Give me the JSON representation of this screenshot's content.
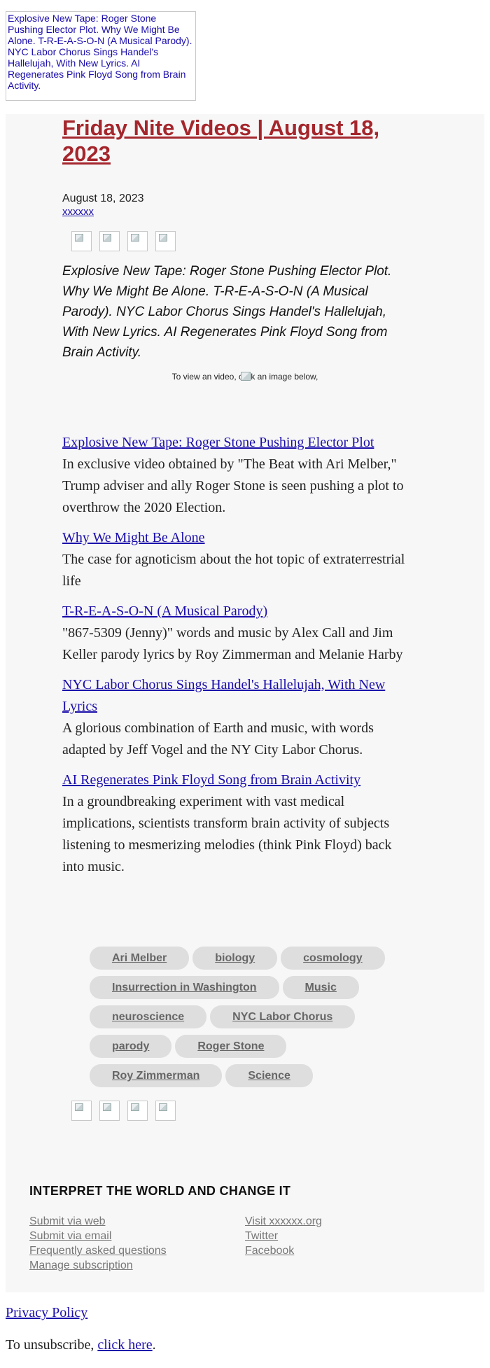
{
  "header": {
    "image_alt": "Explosive New Tape: Roger Stone Pushing Elector Plot. Why We Might Be Alone. T-R-E-A-S-O-N (A Musical Parody). NYC Labor Chorus Sings Handel's Hallelujah, With New Lyrics. AI Regenerates Pink Floyd Song from Brain Activity."
  },
  "article": {
    "title": "Friday Nite Videos | August 18, 2023",
    "date": "August 18, 2023",
    "author": "xxxxxx",
    "intro": "Explosive New Tape: Roger Stone Pushing Elector Plot. Why We Might Be Alone. T-R-E-A-S-O-N (A Musical Parody). NYC Labor Chorus Sings Handel's Hallelujah, With New Lyrics. AI Regenerates Pink Floyd Song from Brain Activity.",
    "view_note": "To view an video, click an image below,"
  },
  "videos": [
    {
      "title": "Explosive New Tape: Roger Stone Pushing Elector Plot",
      "description": "In exclusive video obtained by \"The Beat with Ari Melber,\" Trump adviser and ally Roger Stone is seen pushing a plot to overthrow the 2020 Election."
    },
    {
      "title": "Why We Might Be Alone",
      "description": "The case for agnoticism about the hot topic of extraterrestrial life"
    },
    {
      "title": "T-R-E-A-S-O-N (A Musical Parody)",
      "description": "\"867-5309 (Jenny)\" words and music by Alex Call and Jim Keller parody lyrics by Roy Zimmerman and Melanie Harby"
    },
    {
      "title": "NYC Labor Chorus Sings Handel's Hallelujah, With New Lyrics",
      "description": "A glorious combination of Earth and music, with words adapted by Jeff Vogel and the NY City Labor Chorus."
    },
    {
      "title": "AI Regenerates Pink Floyd Song from Brain Activity",
      "description": "In a groundbreaking experiment with vast medical implications, scientists transform brain activity of subjects listening to mesmerizing melodies (think Pink Floyd) back into music."
    }
  ],
  "tags": [
    "Ari Melber",
    "biology",
    "cosmology",
    "Insurrection in Washington",
    "Music",
    "neuroscience",
    "NYC Labor Chorus",
    "parody",
    "Roger Stone",
    "Roy Zimmerman",
    "Science"
  ],
  "footer": {
    "heading": "INTERPRET THE WORLD AND CHANGE IT",
    "left_links": [
      "Submit via web",
      "Submit via email",
      "Frequently asked questions",
      "Manage subscription"
    ],
    "right_links": [
      "Visit xxxxxx.org",
      "Twitter",
      "Facebook"
    ]
  },
  "privacy_label": "Privacy Policy",
  "unsubscribe": {
    "prefix": "To unsubscribe, ",
    "link": "click here",
    "suffix": "."
  },
  "colors": {
    "title": "#a4262c",
    "link": "#1a0dab",
    "panel": "#f7f7f7",
    "tag_bg": "#dedede"
  }
}
